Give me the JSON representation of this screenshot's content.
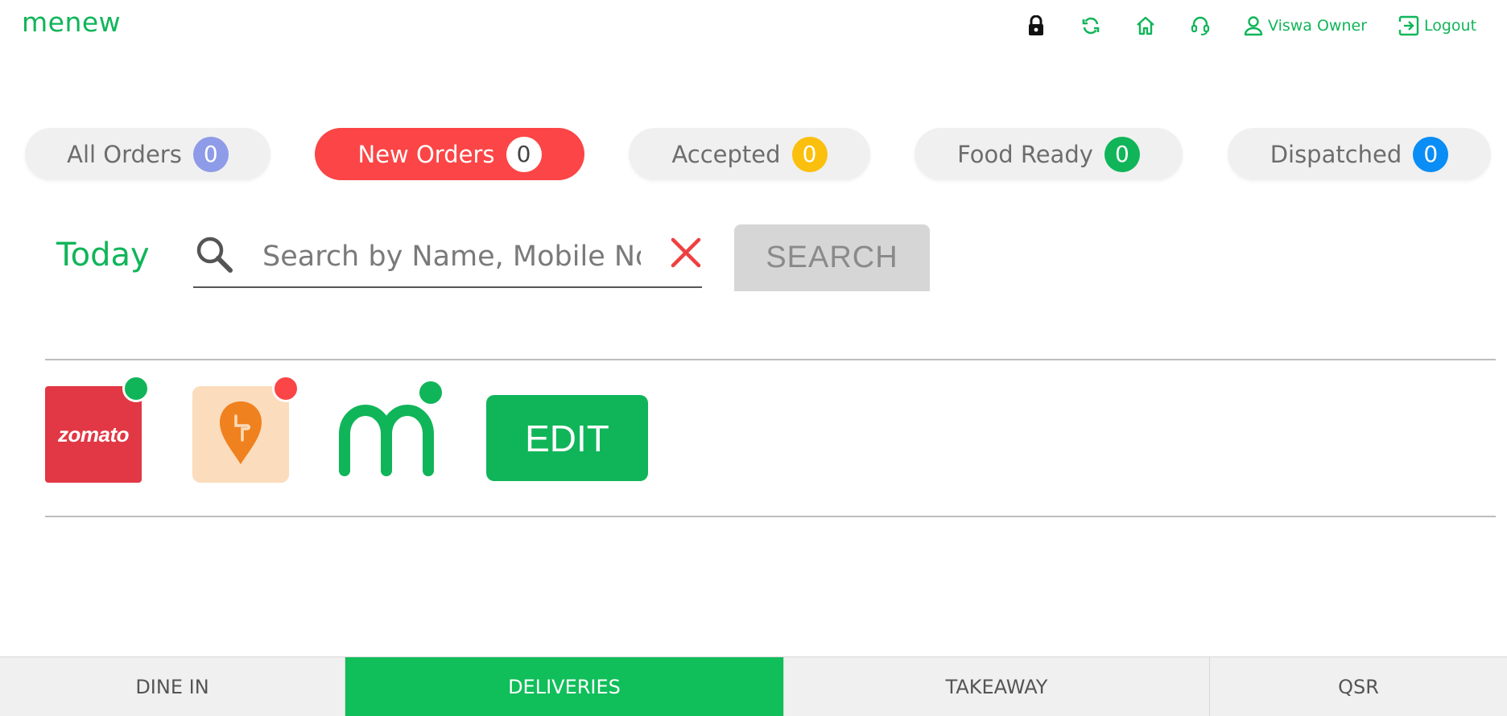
{
  "app": {
    "logo": "menew",
    "brand_color": "#10b559"
  },
  "header": {
    "icons": [
      "lock-icon",
      "refresh-icon",
      "home-icon",
      "support-icon"
    ],
    "user_label": "Viswa Owner",
    "logout_label": "Logout"
  },
  "status_pills": [
    {
      "label": "All Orders",
      "count": "0",
      "badge_color": "#8e9be8",
      "active": false
    },
    {
      "label": "New Orders",
      "count": "0",
      "badge_color": "#ffffff",
      "active": true
    },
    {
      "label": "Accepted",
      "count": "0",
      "badge_color": "#fbbf0d",
      "active": false
    },
    {
      "label": "Food Ready",
      "count": "0",
      "badge_color": "#10b559",
      "active": false
    },
    {
      "label": "Dispatched",
      "count": "0",
      "badge_color": "#0a8df5",
      "active": false
    }
  ],
  "filter": {
    "date_label": "Today",
    "search_placeholder": "Search by Name, Mobile No",
    "search_value": "",
    "search_button": "SEARCH"
  },
  "platforms": [
    {
      "name": "zomato",
      "label": "zomato",
      "status": "online",
      "status_color": "#10b559"
    },
    {
      "name": "swiggy",
      "status": "offline",
      "status_color": "#fb4546"
    },
    {
      "name": "menew",
      "status": "online",
      "status_color": "#10b559"
    }
  ],
  "edit_button": "EDIT",
  "bottom_tabs": [
    {
      "label": "DINE IN",
      "active": false
    },
    {
      "label": "DELIVERIES",
      "active": true
    },
    {
      "label": "TAKEAWAY",
      "active": false
    },
    {
      "label": "QSR",
      "active": false
    }
  ]
}
